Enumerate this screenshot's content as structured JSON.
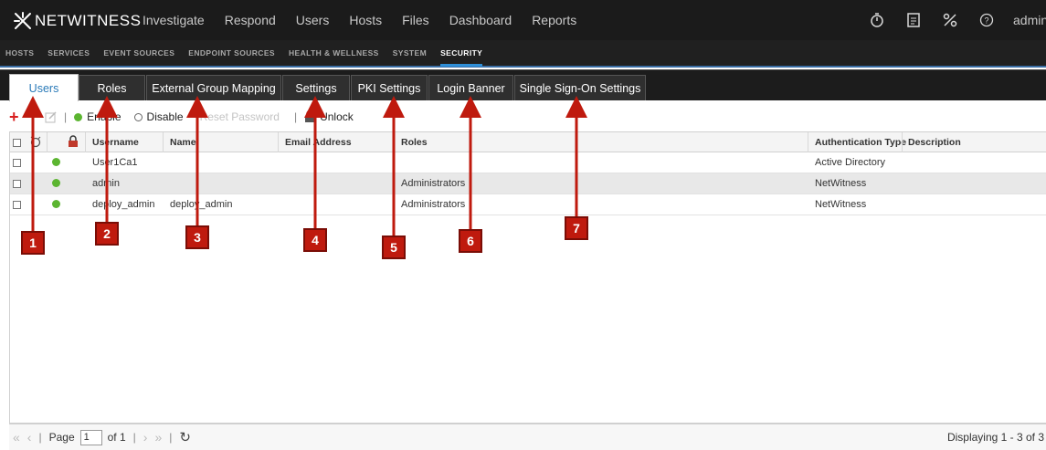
{
  "app": {
    "logo_text": "NETWITNESS",
    "main_nav": [
      "Investigate",
      "Respond",
      "Users",
      "Hosts",
      "Files",
      "Dashboard",
      "Reports"
    ],
    "user_label": "admin"
  },
  "sub_nav": {
    "items": [
      "HOSTS",
      "SERVICES",
      "EVENT SOURCES",
      "ENDPOINT SOURCES",
      "HEALTH & WELLNESS",
      "SYSTEM",
      "SECURITY"
    ],
    "active": "SECURITY"
  },
  "tabs": [
    "Users",
    "Roles",
    "External Group Mapping",
    "Settings",
    "PKI Settings",
    "Login Banner",
    "Single Sign-On Settings"
  ],
  "active_tab": "Users",
  "toolbar": {
    "enable": "Enable",
    "disable": "Disable",
    "reset_password": "Reset Password",
    "unlock": "Unlock"
  },
  "table": {
    "columns": {
      "username": "Username",
      "name": "Name",
      "email": "Email Address",
      "roles": "Roles",
      "auth_type": "Authentication Type",
      "description": "Description"
    },
    "rows": [
      {
        "username": "User1Ca1",
        "name": "",
        "email": "",
        "roles": "",
        "auth_type": "Active Directory",
        "description": "",
        "status": "enabled"
      },
      {
        "username": "admin",
        "name": "",
        "email": "",
        "roles": "Administrators",
        "auth_type": "NetWitness",
        "description": "",
        "status": "enabled"
      },
      {
        "username": "deploy_admin",
        "name": "deploy_admin",
        "email": "",
        "roles": "Administrators",
        "auth_type": "NetWitness",
        "description": "",
        "status": "enabled"
      }
    ]
  },
  "pager": {
    "page_label": "Page",
    "page_value": "1",
    "of_label": "of 1",
    "display_text": "Displaying 1 - 3 of 3"
  },
  "callouts": [
    "1",
    "2",
    "3",
    "4",
    "5",
    "6",
    "7"
  ],
  "colors": {
    "callout": "#bf1a0e",
    "active_tab_text": "#2a7ab8",
    "status_enabled": "#5cb531",
    "accent": "#2f8fd8"
  }
}
